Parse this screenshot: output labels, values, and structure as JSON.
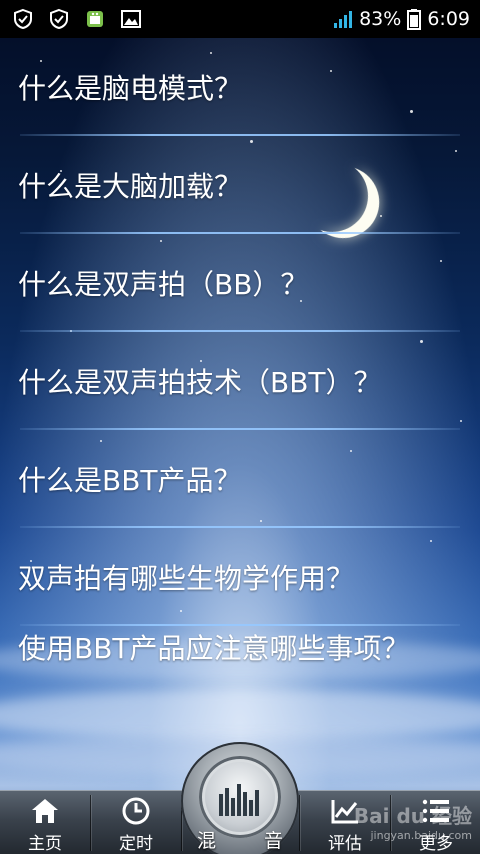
{
  "status_bar": {
    "battery": "83%",
    "time": "6:09",
    "icons": [
      "shield-check-icon",
      "shield-check-icon",
      "android-app-icon",
      "image-icon",
      "signal-icon",
      "battery-icon"
    ]
  },
  "questions": [
    "什么是脑电模式？",
    "什么是大脑加载？",
    "什么是双声拍（BB）？",
    "什么是双声拍技术（BBT）？",
    "什么是BBT产品？",
    "双声拍有哪些生物学作用？",
    "使用BBT产品应注意哪些事项？"
  ],
  "tabs": {
    "home": {
      "label": "主页",
      "icon": "home-icon"
    },
    "timer": {
      "label": "定时",
      "icon": "clock-icon"
    },
    "mix_left": "混",
    "mix_right": "音",
    "mix_icon": "equalizer-icon",
    "evaluate": {
      "label": "评估",
      "icon": "chart-icon"
    },
    "more": {
      "label": "更多",
      "icon": "menu-icon"
    }
  },
  "watermark": {
    "main": "Bai du 经验",
    "sub": "jingyan.baidu.com"
  },
  "colors": {
    "status_bar": "#000000",
    "signal": "#33b5e5",
    "divider": "#96c8ff",
    "tabbar_top": "#5a6470",
    "tabbar_bottom": "#22282f"
  }
}
